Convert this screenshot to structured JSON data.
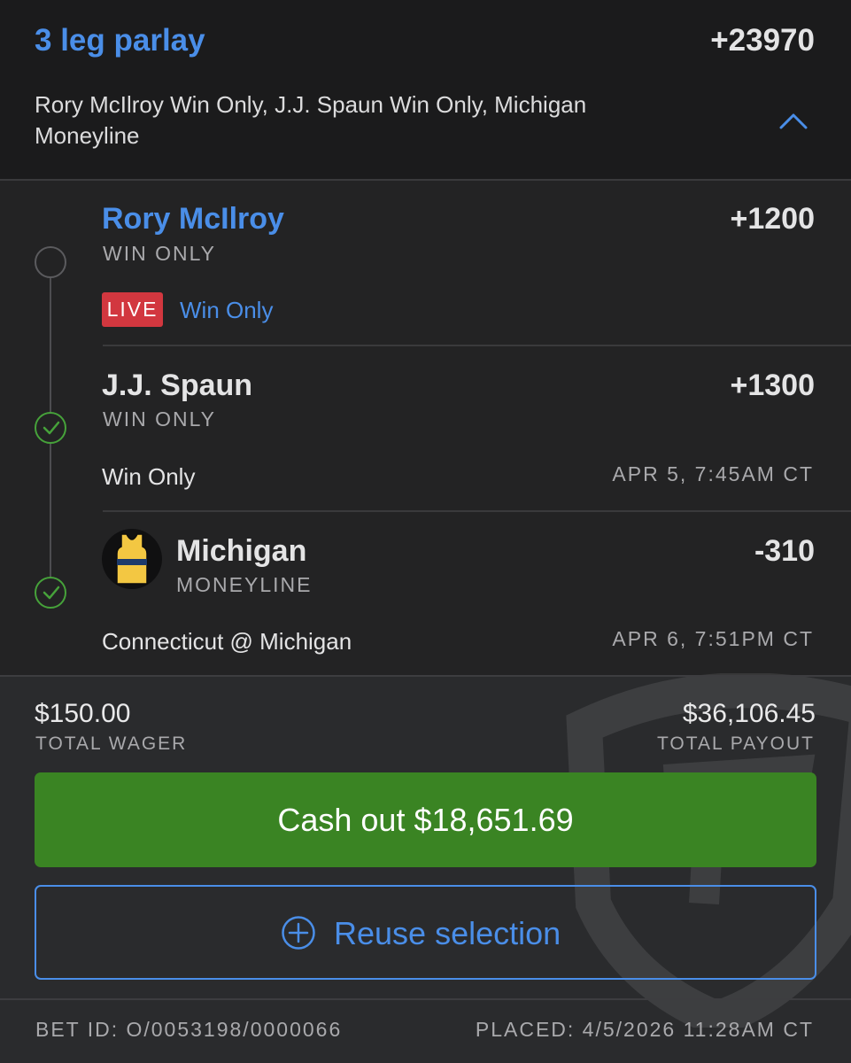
{
  "parlay": {
    "title": "3 leg parlay",
    "odds": "+23970",
    "summary": "Rory McIlroy Win Only, J.J. Spaun Win Only, Michigan Moneyline"
  },
  "legs": [
    {
      "name": "Rory McIlroy",
      "type": "WIN ONLY",
      "odds": "+1200",
      "status": "live",
      "badge": "LIVE",
      "market": "Win Only",
      "name_color": "#4a8ee8"
    },
    {
      "name": "J.J. Spaun",
      "type": "WIN ONLY",
      "odds": "+1300",
      "status": "won",
      "market": "Win Only",
      "date": "APR 5, 7:45AM CT"
    },
    {
      "name": "Michigan",
      "type": "MONEYLINE",
      "odds": "-310",
      "status": "won",
      "icon": "jersey-icon",
      "event": "Connecticut @ Michigan",
      "date": "APR 6, 7:51PM CT"
    }
  ],
  "totals": {
    "wager": "$150.00",
    "wager_label": "TOTAL WAGER",
    "payout": "$36,106.45",
    "payout_label": "TOTAL PAYOUT"
  },
  "actions": {
    "cashout_label": "Cash out $18,651.69",
    "reuse_label": "Reuse selection"
  },
  "meta": {
    "bet_id": "BET ID: O/0053198/0000066",
    "placed": "PLACED: 4/5/2026 11:28AM CT"
  },
  "colors": {
    "accent_blue": "#4a8ee8",
    "success_green": "#46a23a",
    "cashout_green": "#3a8423",
    "live_red": "#d2373f",
    "michigan_maize": "#f3c742",
    "michigan_blue": "#1d3a6b"
  }
}
